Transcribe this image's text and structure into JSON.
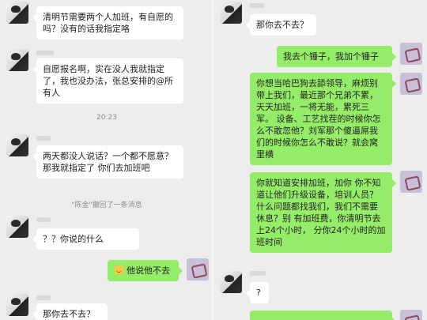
{
  "left": {
    "messages": [
      {
        "text": "清明节需要两个人加班，有自愿的吗？没有的话我指定咯"
      },
      {
        "text": "自愿报名啊，实在没人我就指定了，我也没办法，张总安排的@所有人"
      },
      {
        "text": "两天都没人说话？一个都不愿意？那我就指定了 你们去加班吧"
      },
      {
        "text": "？？你说的什么"
      },
      {
        "text": "他说他不去"
      },
      {
        "text": "那你去不去？"
      }
    ],
    "time": "20:23",
    "recall_notice": "\"陈金\"撤回了一条消息"
  },
  "right": {
    "messages": [
      {
        "text": "那你去不去？"
      },
      {
        "text": "我去个锤子，我加个锤子"
      },
      {
        "text": "你想当哈巴狗去舔领导，麻烦别带上我们，最近那个兄弟不累，天天加班，一将无能，累死三军。 设备、工艺找茬的时候你怎么不敢忽他？刘军那个傻逼屌我们的时候你怎么不敢说？就会窝里横"
      },
      {
        "text": "你就知道安排加班，加你 你不知道让他们升级设备，培训人员？什么问题都找我们，我们不需要休息？别 有加班费，你清明节去上24个小时， 分你24个小时的加班时间"
      },
      {
        "text": "?"
      }
    ]
  },
  "icons": {
    "emoji": "smiley-emoji-icon"
  }
}
